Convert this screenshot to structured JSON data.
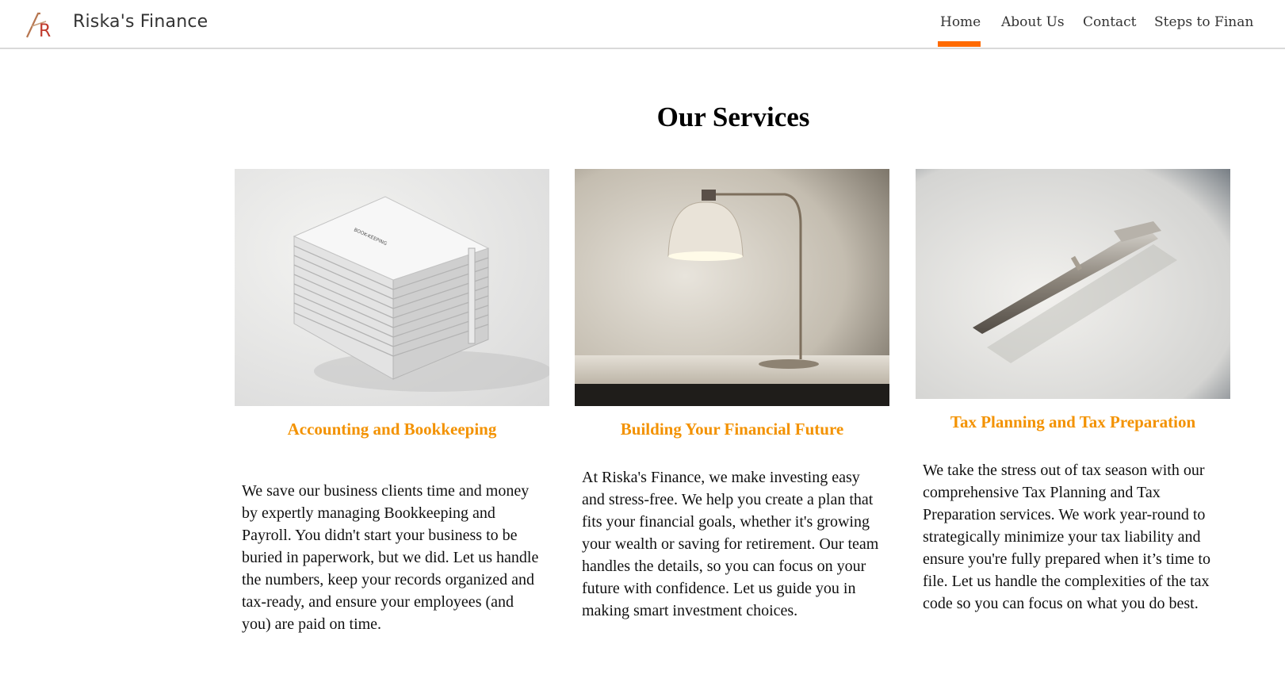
{
  "header": {
    "brand": "Riska's Finance",
    "logo_letter": "R",
    "nav": [
      {
        "label": "Home",
        "active": true
      },
      {
        "label": "About Us",
        "active": false
      },
      {
        "label": "Contact",
        "active": false
      },
      {
        "label": "Steps to Finan",
        "active": false
      }
    ],
    "accent_color": "#ff6a00"
  },
  "main": {
    "title": "Our Services",
    "heading_color": "#f39200",
    "services": [
      {
        "image_icon": "stacked-bookkeeping-binders-image",
        "book_label": "BOOK-KEEPING",
        "heading": "Accounting and Bookkeeping",
        "text": "We save our business clients time and money by expertly managing Bookkeeping and Payroll. You didn't start your business to be buried in paperwork, but we did. Let us handle the numbers, keep your records organized and tax-ready, and ensure your employees (and you) are paid on time."
      },
      {
        "image_icon": "desk-lamp-image",
        "heading": "Building Your Financial Future",
        "text": "At Riska's Finance, we make investing easy and stress-free. We help you create a plan that fits your financial goals, whether it's growing your wealth or saving for retirement. Our team handles the details, so you can focus on your future with confidence. Let us guide you in making smart investment choices."
      },
      {
        "image_icon": "silver-pen-image",
        "heading": "Tax Planning and Tax Preparation",
        "text": "We take the stress out of tax season with our comprehensive Tax Planning and Tax Preparation services. We work year-round to strategically minimize your tax liability and ensure you're fully prepared when it’s time to file. Let us handle the complexities of the tax code so you can focus on what you do best."
      }
    ]
  }
}
